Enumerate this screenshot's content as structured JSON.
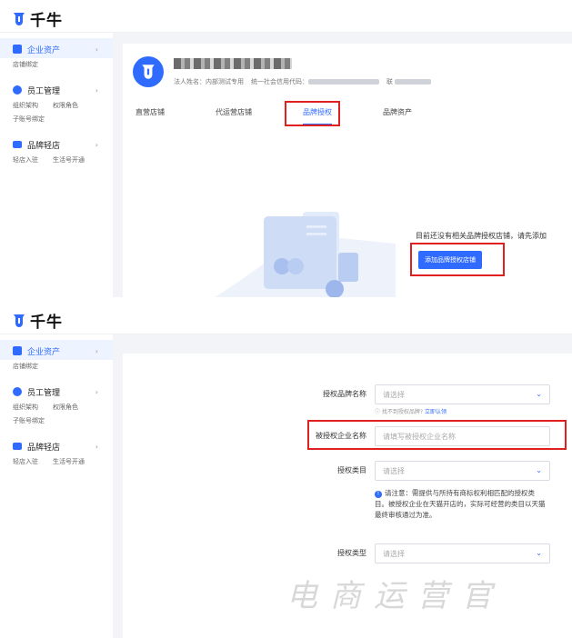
{
  "brand": {
    "name": "千牛"
  },
  "sidebar": {
    "groups": [
      {
        "title": "企业资产",
        "subs": [
          "店铺绑定"
        ]
      },
      {
        "title": "员工管理",
        "subs": [
          "组织架构",
          "权限角色"
        ],
        "subs2": [
          "子账号绑定"
        ]
      },
      {
        "title": "品牌轻店",
        "subs": [
          "轻店入驻",
          "生活号开通"
        ]
      }
    ]
  },
  "company": {
    "legal_person": "法人姓名：内部测试专用",
    "credit_code_label": "统一社会信用代码：",
    "contact_label": "联"
  },
  "tabs": [
    "直营店铺",
    "代运营店铺",
    "品牌授权",
    "品牌资产"
  ],
  "empty": {
    "text": "目前还没有相关品牌授权店铺，请先添加",
    "button": "添加品牌授权店铺"
  },
  "form": {
    "brand": {
      "label": "授权品牌名称",
      "placeholder": "请选择",
      "hint": "找不到授权品牌?",
      "hint_link": "立即认领"
    },
    "company": {
      "label": "被授权企业名称",
      "placeholder": "请填写被授权企业名称"
    },
    "category": {
      "label": "授权类目",
      "placeholder": "请选择"
    },
    "note": "请注意：需提供与所持有商标权利相匹配的授权类目。被授权企业在天猫开店的，实际可经营的类目以天猫最终审核通过为准。",
    "type": {
      "label": "授权类型",
      "placeholder": "请选择"
    }
  },
  "watermark": "电商运营官",
  "colors": {
    "accent": "#2f6bff",
    "highlight_box": "#e01f1f"
  }
}
